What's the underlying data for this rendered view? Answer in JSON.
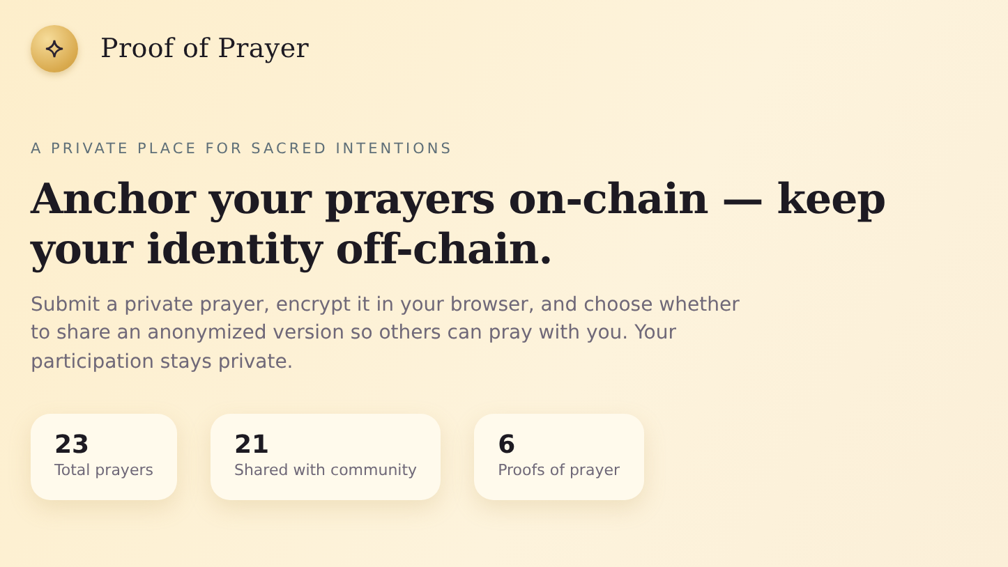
{
  "brand": {
    "title": "Proof of Prayer"
  },
  "hero": {
    "eyebrow": "A PRIVATE PLACE FOR SACRED INTENTIONS",
    "heading": "Anchor your prayers on-chain — keep your identity off-chain.",
    "lead": "Submit a private prayer, encrypt it in your browser, and choose whether to share an anonymized version so others can pray with you. Your participation stays private."
  },
  "stats": [
    {
      "value": "23",
      "label": "Total prayers"
    },
    {
      "value": "21",
      "label": "Shared with community"
    },
    {
      "value": "6",
      "label": "Proofs of prayer"
    }
  ]
}
